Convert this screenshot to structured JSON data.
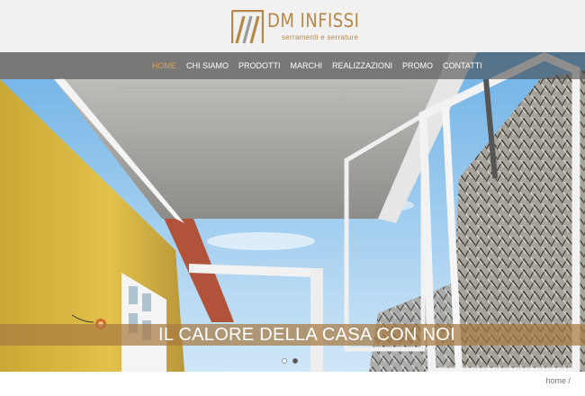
{
  "brand": {
    "name": "DM INFISSI",
    "tagline": "serramenti e serrature",
    "accent_color": "#b5884a"
  },
  "nav": {
    "items": [
      {
        "label": "HOME",
        "active": true
      },
      {
        "label": "CHI SIAMO",
        "active": false
      },
      {
        "label": "PRODOTTI",
        "active": false
      },
      {
        "label": "MARCHI",
        "active": false
      },
      {
        "label": "REALIZZAZIONI",
        "active": false
      },
      {
        "label": "PROMO",
        "active": false
      },
      {
        "label": "CONTATTI",
        "active": false
      }
    ],
    "active_color": "#d9a25c"
  },
  "hero": {
    "caption": "IL CALORE DELLA CASA CON NOI",
    "slide_count": 2,
    "active_slide": 2
  },
  "breadcrumb": {
    "text": "home /"
  }
}
